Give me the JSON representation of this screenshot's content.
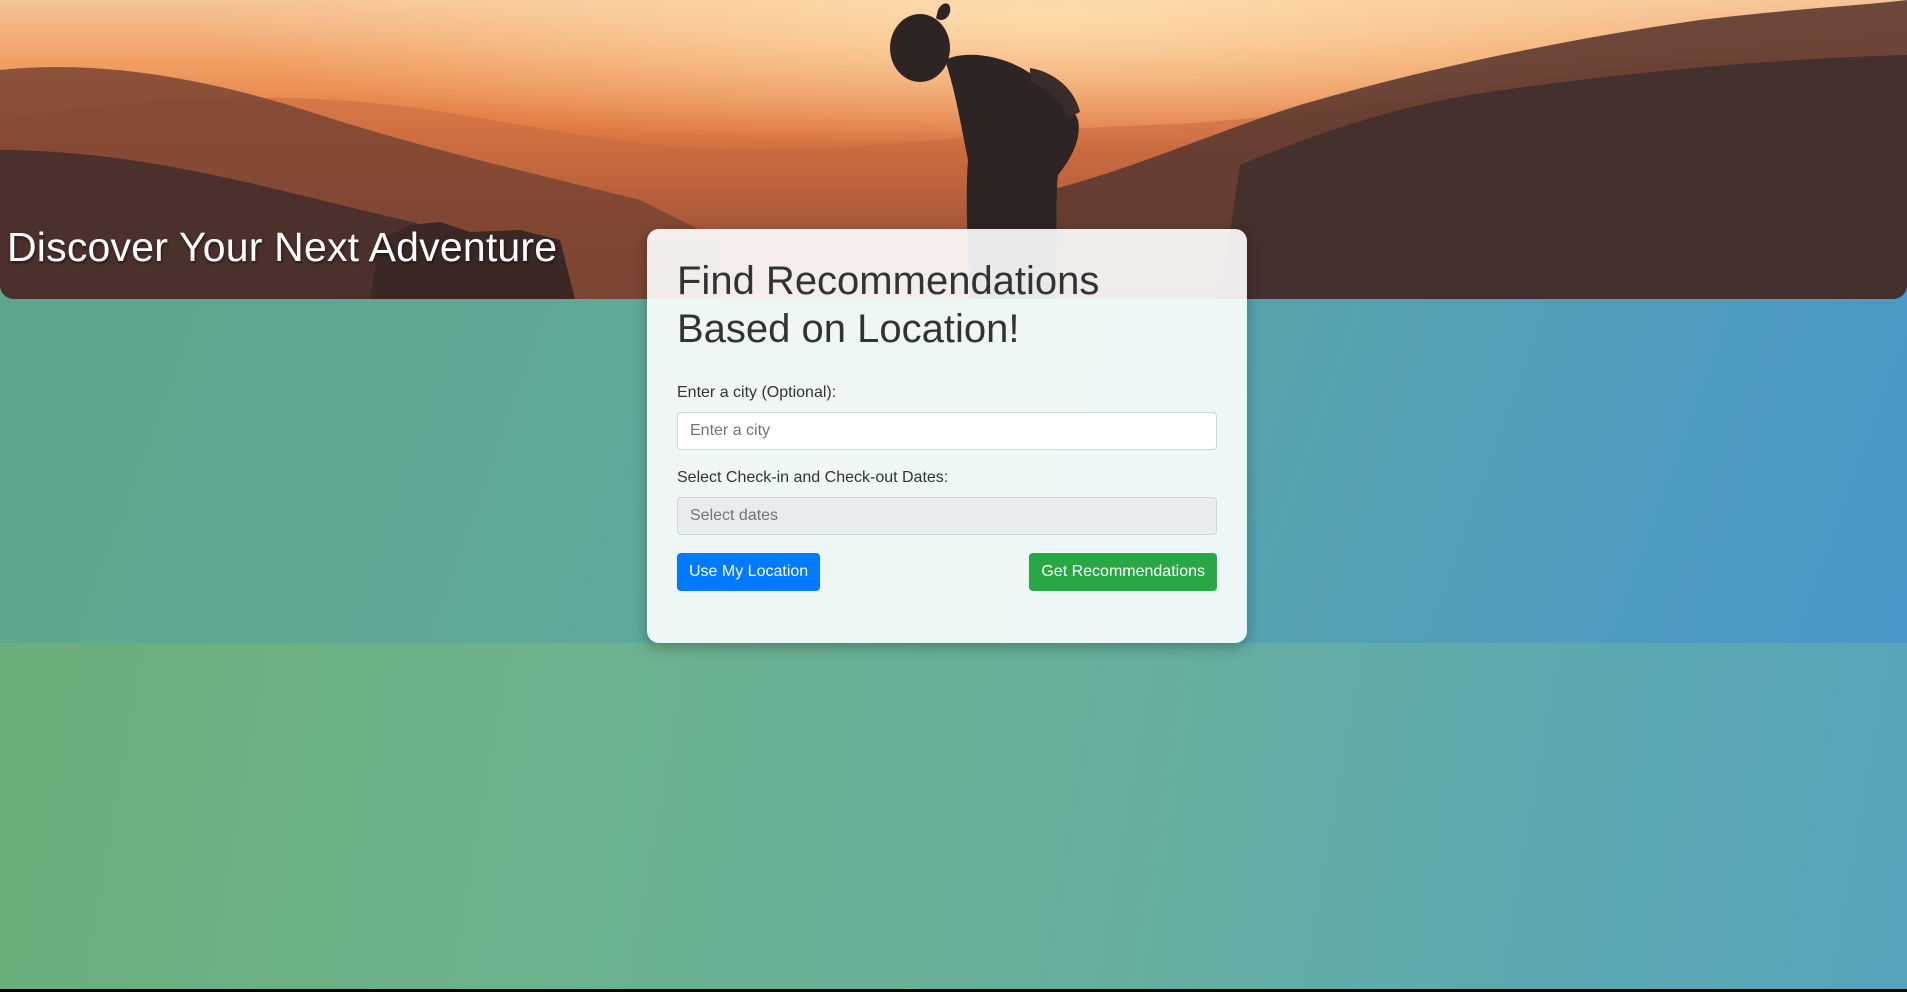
{
  "hero": {
    "title": "Discover Your Next Adventure",
    "image_description_icon": "hiker-silhouette-sunset-image"
  },
  "card": {
    "title": "Find Recommendations Based on Location!",
    "city_label": "Enter a city (Optional):",
    "city_placeholder": "Enter a city",
    "city_value": "",
    "dates_label": "Select Check-in and Check-out Dates:",
    "dates_placeholder": "Select dates",
    "dates_value": "",
    "use_location_label": "Use My Location",
    "get_recommendations_label": "Get Recommendations"
  },
  "colors": {
    "primary_button": "#007bff",
    "success_button": "#28a745",
    "card_background": "#ffffff",
    "heading_text": "#333333"
  }
}
